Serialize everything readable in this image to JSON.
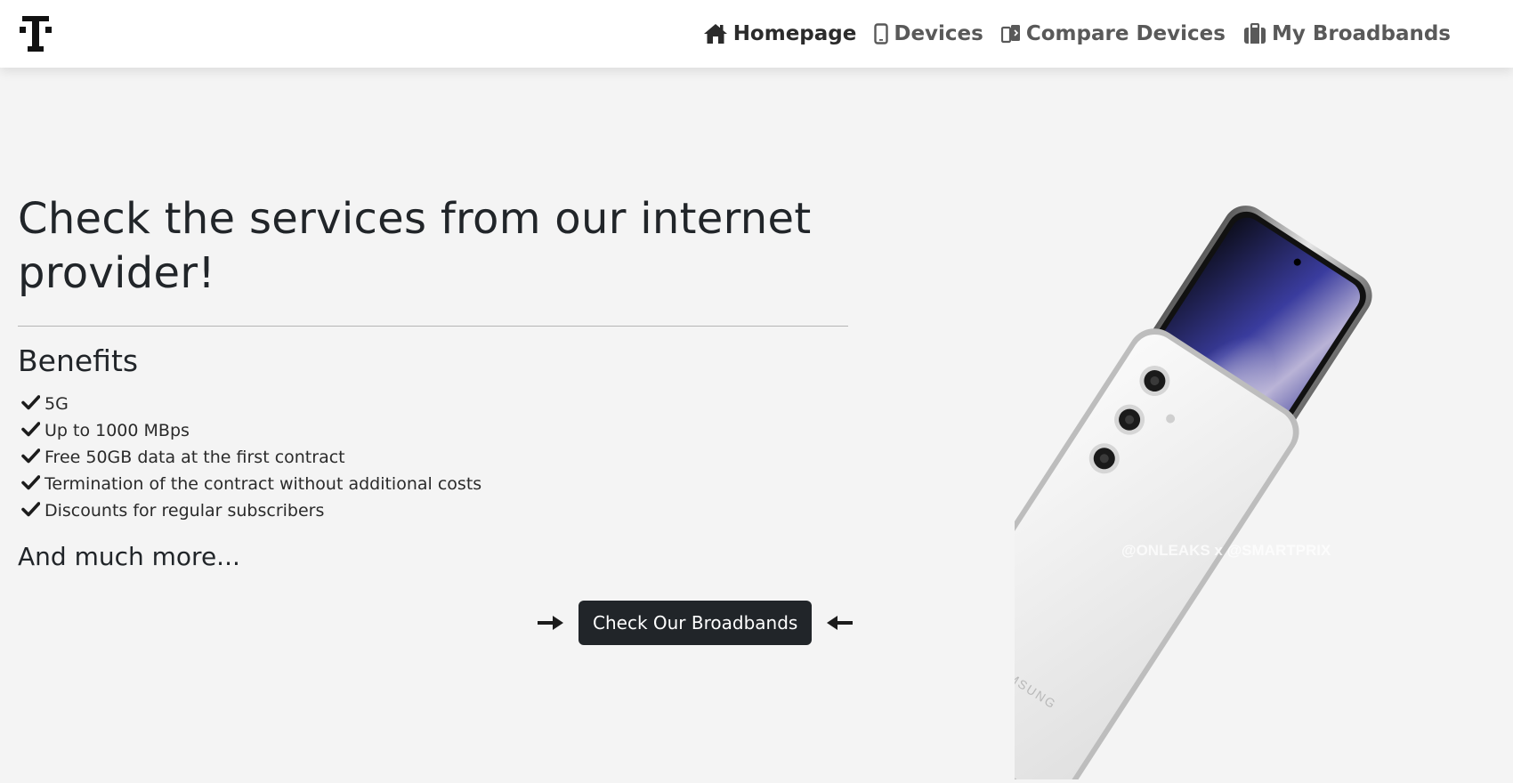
{
  "nav": {
    "logo_icon": "t-logo-icon",
    "links": [
      {
        "label": "Homepage",
        "icon": "home-icon",
        "active": true
      },
      {
        "label": "Devices",
        "icon": "smartphone-icon",
        "active": false
      },
      {
        "label": "Compare Devices",
        "icon": "compare-devices-icon",
        "active": false
      },
      {
        "label": "My Broadbands",
        "icon": "suitcase-icon",
        "active": false
      }
    ]
  },
  "hero": {
    "title": "Check the services from our internet provider!",
    "benefits_heading": "Benefits",
    "benefits": [
      "5G",
      "Up to 1000 MBps",
      "Free 50GB data at the first contract",
      "Termination of the contract without additional costs",
      "Discounts for regular subscribers"
    ],
    "more_text": "And much more...",
    "cta_label": "Check Our Broadbands",
    "cta_left_icon": "arrow-right-icon",
    "cta_right_icon": "arrow-left-icon"
  },
  "image": {
    "alt": "smartphone product image",
    "watermark": "@ONLEAKS x @SMARTPRIX",
    "brand_text": "SAMSUNG"
  },
  "colors": {
    "page_background": "#f4f4f4",
    "nav_background": "#ffffff",
    "button_background": "#212529",
    "button_text": "#ffffff",
    "text_primary": "#212529"
  }
}
